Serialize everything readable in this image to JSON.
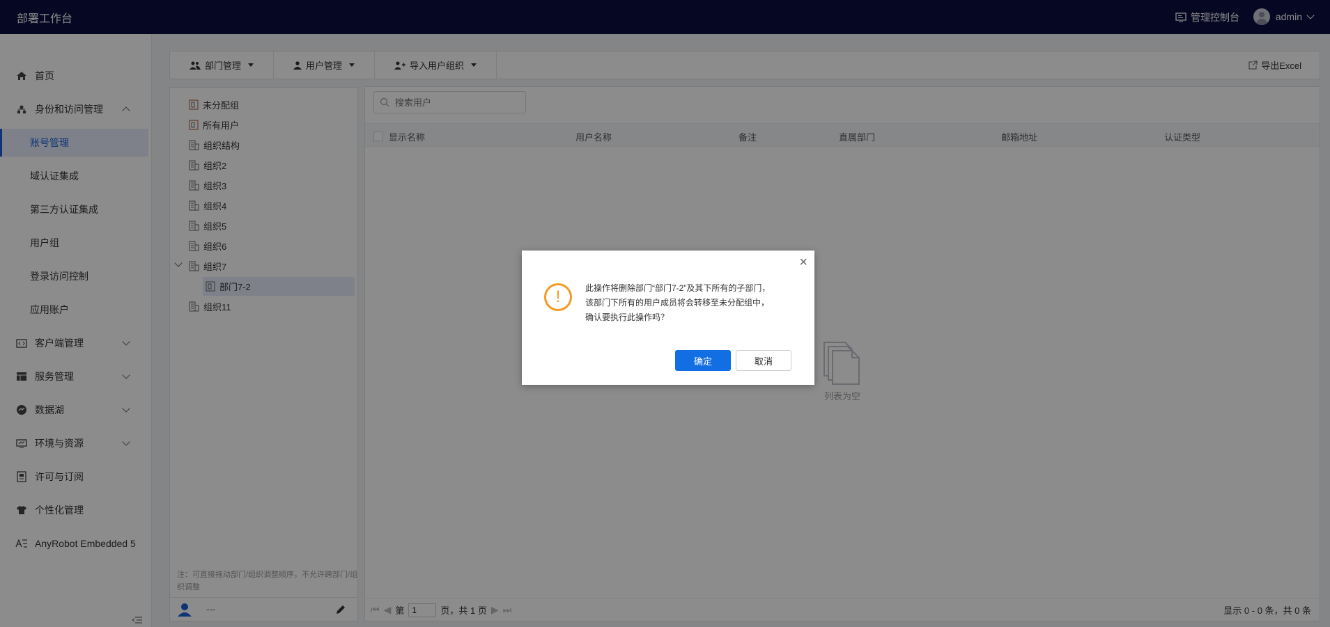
{
  "topbar": {
    "brand": "部署工作台",
    "console_label": "管理控制台",
    "user_name": "admin"
  },
  "sidebar": {
    "items": [
      {
        "label": "首页",
        "icon": "home-icon"
      },
      {
        "label": "身份和访问管理",
        "icon": "org-icon",
        "expanded": true
      },
      {
        "label": "账号管理",
        "active": true
      },
      {
        "label": "域认证集成"
      },
      {
        "label": "第三方认证集成"
      },
      {
        "label": "用户组"
      },
      {
        "label": "登录访问控制"
      },
      {
        "label": "应用账户"
      },
      {
        "label": "客户端管理",
        "icon": "code-icon"
      },
      {
        "label": "服务管理",
        "icon": "table-icon"
      },
      {
        "label": "数据湖",
        "icon": "data-lake-icon"
      },
      {
        "label": "环境与资源",
        "icon": "monitor-icon"
      },
      {
        "label": "许可与订阅",
        "icon": "license-icon"
      },
      {
        "label": "个性化管理",
        "icon": "shirt-icon"
      },
      {
        "label": "AnyRobot Embedded 5",
        "icon": "anyrobot-icon"
      }
    ]
  },
  "toolbar": {
    "dept_mgmt": "部门管理",
    "user_mgmt": "用户管理",
    "import_org": "导入用户组织",
    "export_excel": "导出Excel"
  },
  "tree": {
    "items": [
      "未分配组",
      "所有用户",
      "组织结构",
      "组织2",
      "组织3",
      "组织4",
      "组织5",
      "组织6",
      "组织7",
      "部门7-2",
      "组织11"
    ],
    "note": "注：可直接拖动部门/组织调整顺序，不允许跨部门/组织调整",
    "footer_text": "---"
  },
  "main": {
    "search_placeholder": "搜索用户",
    "columns": [
      "显示名称",
      "用户名称",
      "备注",
      "直属部门",
      "邮箱地址",
      "认证类型"
    ],
    "empty_text": "列表为空",
    "pager": {
      "prefix": "第",
      "page": "1",
      "suffix": "页，共 1 页",
      "summary": "显示 0 - 0 条，共 0 条"
    }
  },
  "dialog": {
    "message_line1": "此操作将删除部门“部门7-2”及其下所有的子部门，",
    "message_line2": "该部门下所有的用户成员将会转移至未分配组中，",
    "message_line3": "确认要执行此操作吗？",
    "ok_label": "确定",
    "cancel_label": "取消",
    "close_glyph": "×",
    "warn_glyph": "!"
  },
  "colors": {
    "topbar": "#0b0d40",
    "accent": "#126ee3",
    "warning": "#f29a21",
    "active_bg": "#e6ecf9"
  }
}
